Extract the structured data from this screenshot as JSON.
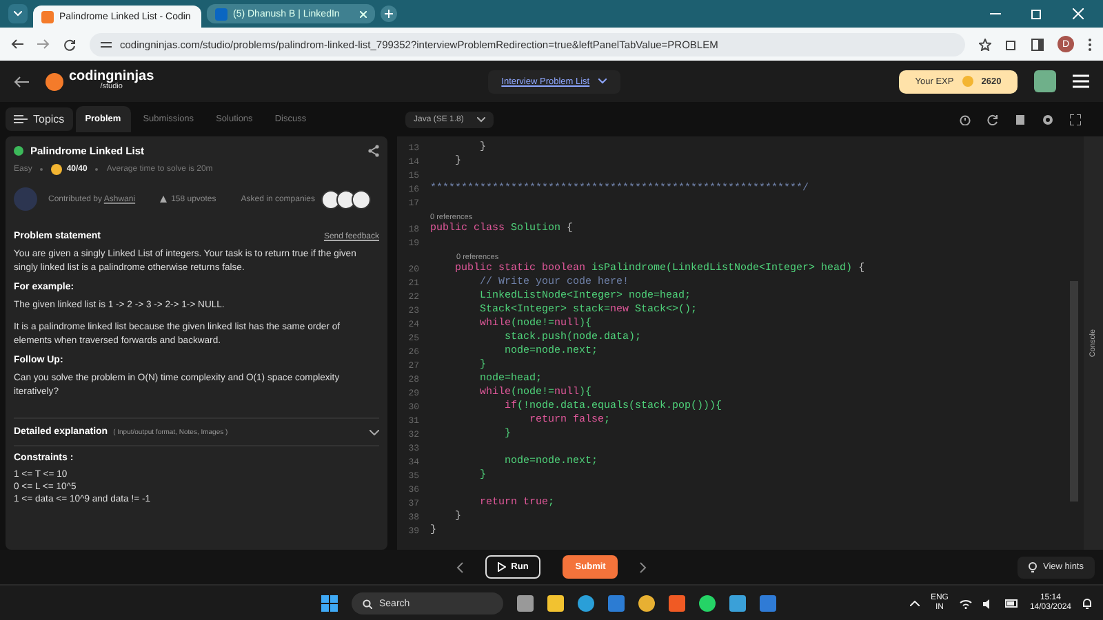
{
  "browser": {
    "tabs": [
      {
        "title": "Palindrome Linked List - Codin",
        "selected": true,
        "kind": "cn"
      },
      {
        "title": "(5) Dhanush B | LinkedIn",
        "selected": false,
        "kind": "in"
      }
    ],
    "url": "codingninjas.com/studio/problems/palindrom-linked-list_799352?interviewProblemRedirection=true&leftPanelTabValue=PROBLEM",
    "profile": "D"
  },
  "header": {
    "logo": "codingninjas",
    "logo_sub": "/studio",
    "center_link": "Interview Problem List",
    "exp_label": "Your EXP",
    "exp_value": "2620"
  },
  "left_tabs": [
    {
      "label": "Topics",
      "selected": false,
      "kind": "topics"
    },
    {
      "label": "Problem",
      "selected": true,
      "kind": "tab"
    },
    {
      "label": "Submissions",
      "selected": false,
      "kind": "tab"
    },
    {
      "label": "Solutions",
      "selected": false,
      "kind": "tab"
    },
    {
      "label": "Discuss",
      "selected": false,
      "kind": "tab"
    }
  ],
  "problem": {
    "title": "Palindrome Linked List",
    "solved": true,
    "difficulty": "Easy",
    "score": "40/40",
    "avg_time": "Average time to solve is 20m",
    "contributed_label": "Contributed by",
    "contributor": "Ashwani",
    "upvotes": "158 upvotes",
    "asked_label": "Asked in companies",
    "statement_heading": "Problem statement",
    "feedback": "Send feedback",
    "blocks": [
      {
        "kind": "p",
        "text": "You are given a singly Linked List of integers. Your task is to return true if the given singly linked list is a palindrome otherwise returns false."
      },
      {
        "kind": "h",
        "text": "For example:"
      },
      {
        "kind": "p",
        "text": "The given linked list is 1 -> 2 -> 3 -> 2-> 1-> NULL."
      },
      {
        "kind": "p",
        "text": "It is a palindrome linked list because the given linked list has the same order of elements when traversed forwards and backward."
      },
      {
        "kind": "h",
        "text": "Follow Up:"
      },
      {
        "kind": "p",
        "text": "Can you solve the problem in O(N) time complexity and O(1) space complexity iteratively?"
      }
    ],
    "explanation_heading": "Detailed explanation",
    "explanation_note": "( Input/output format, Notes, Images )",
    "constraints_heading": "Constraints :",
    "constraints": [
      "1 <= T <= 10",
      "0 <= L <= 10^5",
      "1 <= data <= 10^9 and data != -1"
    ]
  },
  "editor": {
    "language": "Java (SE 1.8)",
    "console_label": "Console",
    "lines": [
      {
        "kind": "code",
        "n": "13",
        "tokens": [
          {
            "color": "#bbbbbb",
            "t": "        }"
          }
        ]
      },
      {
        "kind": "code",
        "n": "14",
        "tokens": [
          {
            "color": "#bbbbbb",
            "t": "    }"
          }
        ]
      },
      {
        "kind": "code",
        "n": "15"
      },
      {
        "kind": "code",
        "n": "16",
        "tokens": [
          {
            "color": "#6f80a8",
            "t": "************************************************************/"
          }
        ]
      },
      {
        "kind": "code",
        "n": "17"
      },
      {
        "kind": "ref",
        "text": "0 references"
      },
      {
        "kind": "code",
        "n": "18",
        "tokens": [
          {
            "color": "#e0589a",
            "t": "public class "
          },
          {
            "color": "#4fd27a",
            "t": "Solution"
          },
          {
            "color": "#bbbbbb",
            "t": " {"
          }
        ]
      },
      {
        "kind": "code",
        "n": "19"
      },
      {
        "kind": "ref_nested",
        "text": "0 references"
      },
      {
        "kind": "code",
        "n": "20",
        "tokens": [
          {
            "color": "#e0589a",
            "t": "    public static boolean "
          },
          {
            "color": "#4fd27a",
            "t": "isPalindrome(LinkedListNode<Integer> head)"
          },
          {
            "color": "#bbbbbb",
            "t": " {"
          }
        ]
      },
      {
        "kind": "code",
        "n": "21",
        "tokens": [
          {
            "color": "#6f80a8",
            "t": "        // Write your code here!"
          }
        ]
      },
      {
        "kind": "code",
        "n": "22",
        "tokens": [
          {
            "color": "#4fd27a",
            "t": "        LinkedListNode<Integer> node=head;"
          }
        ]
      },
      {
        "kind": "code",
        "n": "23",
        "tokens": [
          {
            "color": "#4fd27a",
            "t": "        Stack<Integer> stack="
          },
          {
            "color": "#e0589a",
            "t": "new"
          },
          {
            "color": "#4fd27a",
            "t": " Stack<>();"
          }
        ]
      },
      {
        "kind": "code",
        "n": "24",
        "tokens": [
          {
            "color": "#e0589a",
            "t": "        while"
          },
          {
            "color": "#4fd27a",
            "t": "(node!="
          },
          {
            "color": "#e0589a",
            "t": "null"
          },
          {
            "color": "#4fd27a",
            "t": "){"
          }
        ]
      },
      {
        "kind": "code",
        "n": "25",
        "tokens": [
          {
            "color": "#4fd27a",
            "t": "            stack.push(node.data);"
          }
        ]
      },
      {
        "kind": "code",
        "n": "26",
        "tokens": [
          {
            "color": "#4fd27a",
            "t": "            node=node.next;"
          }
        ]
      },
      {
        "kind": "code",
        "n": "27",
        "tokens": [
          {
            "color": "#4fd27a",
            "t": "        }"
          }
        ]
      },
      {
        "kind": "code",
        "n": "28",
        "tokens": [
          {
            "color": "#4fd27a",
            "t": "        node=head;"
          }
        ]
      },
      {
        "kind": "code",
        "n": "29",
        "tokens": [
          {
            "color": "#e0589a",
            "t": "        while"
          },
          {
            "color": "#4fd27a",
            "t": "(node!="
          },
          {
            "color": "#e0589a",
            "t": "null"
          },
          {
            "color": "#4fd27a",
            "t": "){"
          }
        ]
      },
      {
        "kind": "code",
        "n": "30",
        "tokens": [
          {
            "color": "#e0589a",
            "t": "            if"
          },
          {
            "color": "#4fd27a",
            "t": "(!node.data.equals(stack.pop())){"
          }
        ]
      },
      {
        "kind": "code",
        "n": "31",
        "tokens": [
          {
            "color": "#e0589a",
            "t": "                return false"
          },
          {
            "color": "#4fd27a",
            "t": ";"
          }
        ]
      },
      {
        "kind": "code",
        "n": "32",
        "tokens": [
          {
            "color": "#4fd27a",
            "t": "            }"
          }
        ]
      },
      {
        "kind": "code",
        "n": "33"
      },
      {
        "kind": "code",
        "n": "34",
        "tokens": [
          {
            "color": "#4fd27a",
            "t": "            node=node.next;"
          }
        ]
      },
      {
        "kind": "code",
        "n": "35",
        "tokens": [
          {
            "color": "#4fd27a",
            "t": "        }"
          }
        ]
      },
      {
        "kind": "code",
        "n": "36"
      },
      {
        "kind": "code",
        "n": "37",
        "tokens": [
          {
            "color": "#e0589a",
            "t": "        return true"
          },
          {
            "color": "#4fd27a",
            "t": ";"
          }
        ]
      },
      {
        "kind": "code",
        "n": "38",
        "tokens": [
          {
            "color": "#bbbbbb",
            "t": "    }"
          }
        ]
      },
      {
        "kind": "code",
        "n": "39",
        "tokens": [
          {
            "color": "#bbbbbb",
            "t": "}"
          }
        ]
      }
    ]
  },
  "footer": {
    "run": "Run",
    "submit": "Submit",
    "hints": "View hints"
  },
  "taskbar": {
    "search": "Search",
    "lang": "ENG",
    "region": "IN",
    "time": "15:14",
    "date": "14/03/2024"
  }
}
